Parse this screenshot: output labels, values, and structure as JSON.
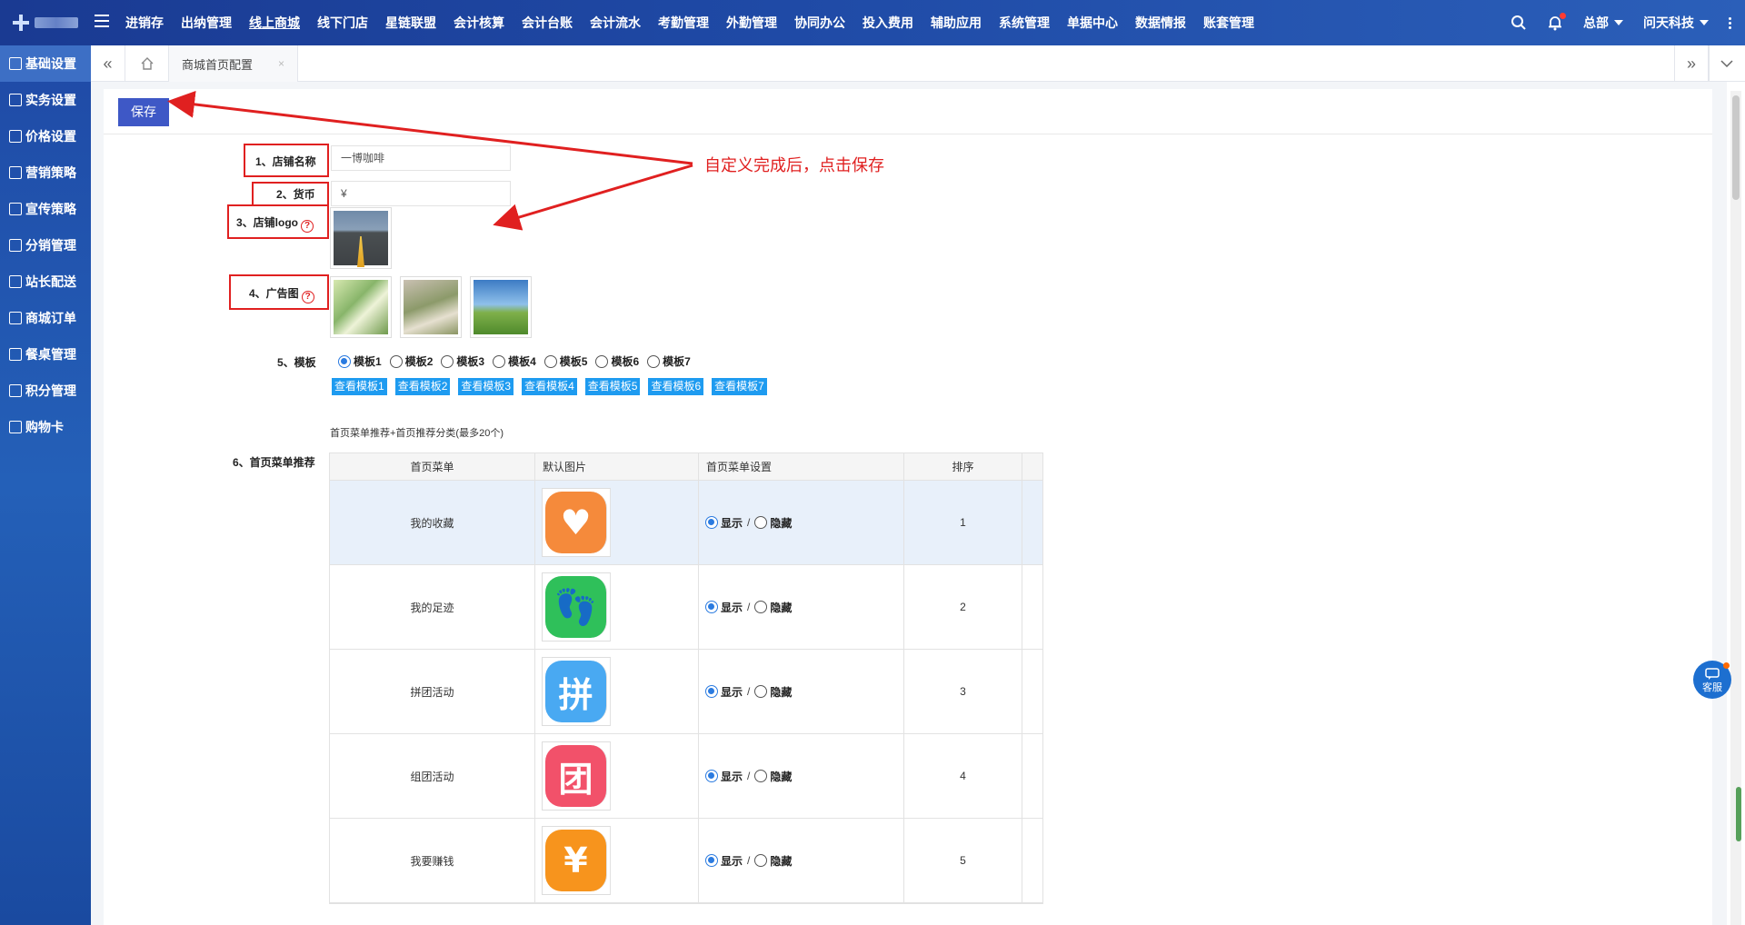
{
  "nav": {
    "items": [
      "进销存",
      "出纳管理",
      "线上商城",
      "线下门店",
      "星链联盟",
      "会计核算",
      "会计台账",
      "会计流水",
      "考勤管理",
      "外勤管理",
      "协同办公",
      "投入费用",
      "辅助应用",
      "系统管理",
      "单据中心",
      "数据情报",
      "账套管理"
    ],
    "active": "线上商城",
    "branch": "总部",
    "company": "问天科技"
  },
  "sidebar": {
    "items": [
      "基础设置",
      "实务设置",
      "价格设置",
      "营销策略",
      "宣传策略",
      "分销管理",
      "站长配送",
      "商城订单",
      "餐桌管理",
      "积分管理",
      "购物卡"
    ],
    "active": "基础设置"
  },
  "tabs": {
    "current": "商城首页配置",
    "close": "×"
  },
  "form": {
    "save_label": "保存",
    "store_name_label": "1、店铺名称",
    "store_name_value": "一博咖啡",
    "currency_label": "2、货币",
    "currency_value": "¥",
    "logo_label": "3、店铺logo",
    "ad_label": "4、广告图",
    "help_glyph": "?",
    "template_label": "5、模板",
    "templates": [
      "模板1",
      "模板2",
      "模板3",
      "模板4",
      "模板5",
      "模板6",
      "模板7"
    ],
    "selected_template": "模板1",
    "view_buttons": [
      "查看模板1",
      "查看模板2",
      "查看模板3",
      "查看模板4",
      "查看模板5",
      "查看模板6",
      "查看模板7"
    ],
    "menu_note": "首页菜单推荐+首页推荐分类(最多20个)",
    "menu_label": "6、首页菜单推荐"
  },
  "annotation": "自定义完成后，点击保存",
  "table": {
    "headers": [
      "首页菜单",
      "默认图片",
      "首页菜单设置",
      "排序"
    ],
    "show_label": "显示",
    "hide_label": "隐藏",
    "separator": "/",
    "rows": [
      {
        "name": "我的收藏",
        "order": "1",
        "icon": "heart-icon",
        "color": "#f58a3b",
        "glyph": "♥"
      },
      {
        "name": "我的足迹",
        "order": "2",
        "icon": "footprint-icon",
        "color": "#2fc05a",
        "glyph": "👣"
      },
      {
        "name": "拼团活动",
        "order": "3",
        "icon": "pin-icon",
        "color": "#49a9f2",
        "glyph": "拼"
      },
      {
        "name": "组团活动",
        "order": "4",
        "icon": "tuan-icon",
        "color": "#f2516a",
        "glyph": "团"
      },
      {
        "name": "我要赚钱",
        "order": "5",
        "icon": "coupon-icon",
        "color": "#f7941d",
        "glyph": "¥"
      }
    ]
  },
  "kefu_label": "客服",
  "colors": {
    "accent": "#3e58c6",
    "annotation": "#e02020",
    "view_button": "#1e9bf0",
    "radio_on": "#2b7be0"
  }
}
